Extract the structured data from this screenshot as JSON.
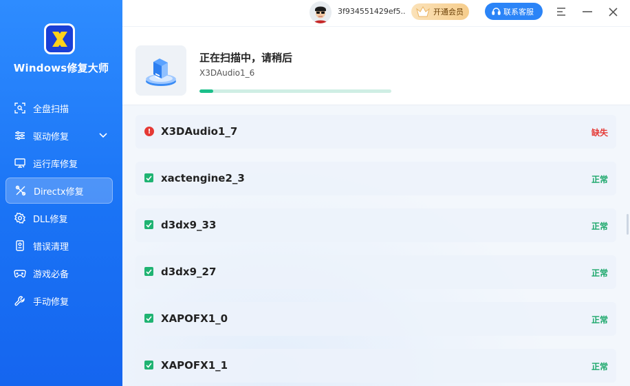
{
  "sidebar": {
    "app_name": "Windows修复大师",
    "items": [
      {
        "label": "全盘扫描",
        "icon": "scan-icon"
      },
      {
        "label": "驱动修复",
        "icon": "sliders-icon"
      },
      {
        "label": "运行库修复",
        "icon": "monitor-icon"
      },
      {
        "label": "Directx修复",
        "icon": "tools-icon"
      },
      {
        "label": "DLL修复",
        "icon": "gear-icon"
      },
      {
        "label": "错误清理",
        "icon": "document-icon"
      },
      {
        "label": "游戏必备",
        "icon": "gamepad-icon"
      },
      {
        "label": "手动修复",
        "icon": "wrench-icon"
      }
    ],
    "active_index": 3
  },
  "topbar": {
    "user_id": "3f934551429ef5..",
    "vip_label": "开通会员",
    "support_label": "联系客服"
  },
  "scan": {
    "title": "正在扫描中，请稍后",
    "current_item": "X3DAudio1_6",
    "progress": 0.07
  },
  "items": [
    {
      "name": "X3DAudio1_7",
      "status": "缺失",
      "state": "error",
      "status_color": "#e53935"
    },
    {
      "name": "xactengine2_3",
      "status": "正常",
      "state": "ok",
      "status_color": "#1aa76a"
    },
    {
      "name": "d3dx9_33",
      "status": "正常",
      "state": "ok",
      "status_color": "#1aa76a"
    },
    {
      "name": "d3dx9_27",
      "status": "正常",
      "state": "ok",
      "status_color": "#1aa76a"
    },
    {
      "name": "XAPOFX1_0",
      "status": "正常",
      "state": "ok",
      "status_color": "#1aa76a"
    },
    {
      "name": "XAPOFX1_1",
      "status": "正常",
      "state": "ok",
      "status_color": "#1aa76a"
    }
  ]
}
